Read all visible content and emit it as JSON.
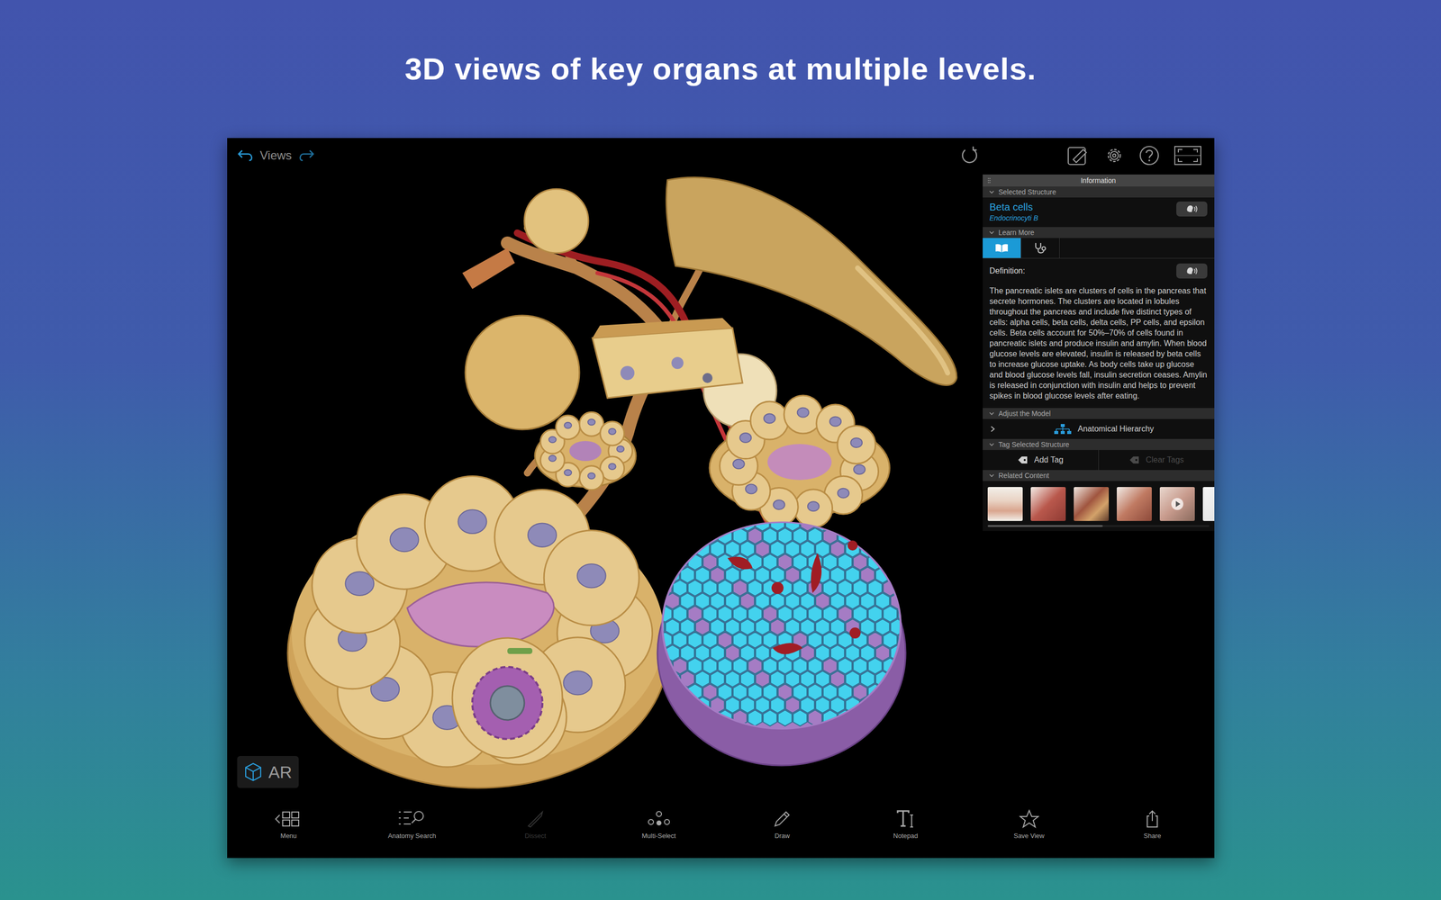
{
  "headline": "3D views of key organs at multiple levels.",
  "nav": {
    "label": "Views"
  },
  "ar_button": {
    "label": "AR"
  },
  "panel": {
    "title": "Information",
    "selected_structure": {
      "header": "Selected Structure",
      "expanded": true,
      "name": "Beta cells",
      "latin": "Endocrinocyti B"
    },
    "learn_more": {
      "header": "Learn More",
      "expanded": true,
      "tabs": [
        {
          "selected": true
        },
        {
          "selected": false
        }
      ],
      "definition_label": "Definition:",
      "definition": "The pancreatic islets are clusters of cells in the pancreas that secrete hormones. The clusters are located in lobules throughout the pancreas and include five distinct types of cells: alpha cells, beta cells, delta cells, PP cells, and epsilon cells. Beta cells account for 50%–70% of cells found in pancreatic islets and produce insulin and amylin. When blood glucose levels are elevated, insulin is released by beta cells to increase glucose uptake. As body cells take up glucose and blood glucose levels fall, insulin secretion ceases. Amylin is released in conjunction with insulin and helps to prevent spikes in blood glucose levels after eating."
    },
    "adjust": {
      "header": "Adjust the Model",
      "expanded": true,
      "rows": [
        {
          "label": "Anatomical Hierarchy",
          "expanded": false
        }
      ]
    },
    "tags": {
      "header": "Tag Selected Structure",
      "expanded": true,
      "buttons": [
        {
          "label": "Add Tag",
          "disabled": false
        },
        {
          "label": "Clear Tags",
          "disabled": true
        }
      ]
    },
    "related": {
      "header": "Related Content",
      "expanded": true,
      "thumbnails": [
        {
          "kind": "image"
        },
        {
          "kind": "image"
        },
        {
          "kind": "image"
        },
        {
          "kind": "image"
        },
        {
          "kind": "video"
        },
        {
          "kind": "image"
        }
      ],
      "scroll": {
        "level": 0.52
      }
    }
  },
  "toolbar": [
    {
      "label": "Menu",
      "disabled": false
    },
    {
      "label": "Anatomy Search",
      "disabled": false
    },
    {
      "label": "Dissect",
      "disabled": true
    },
    {
      "label": "Multi-Select",
      "disabled": false
    },
    {
      "label": "Draw",
      "disabled": false
    },
    {
      "label": "Notepad",
      "disabled": false
    },
    {
      "label": "Save View",
      "disabled": false
    },
    {
      "label": "Share",
      "disabled": false
    }
  ]
}
